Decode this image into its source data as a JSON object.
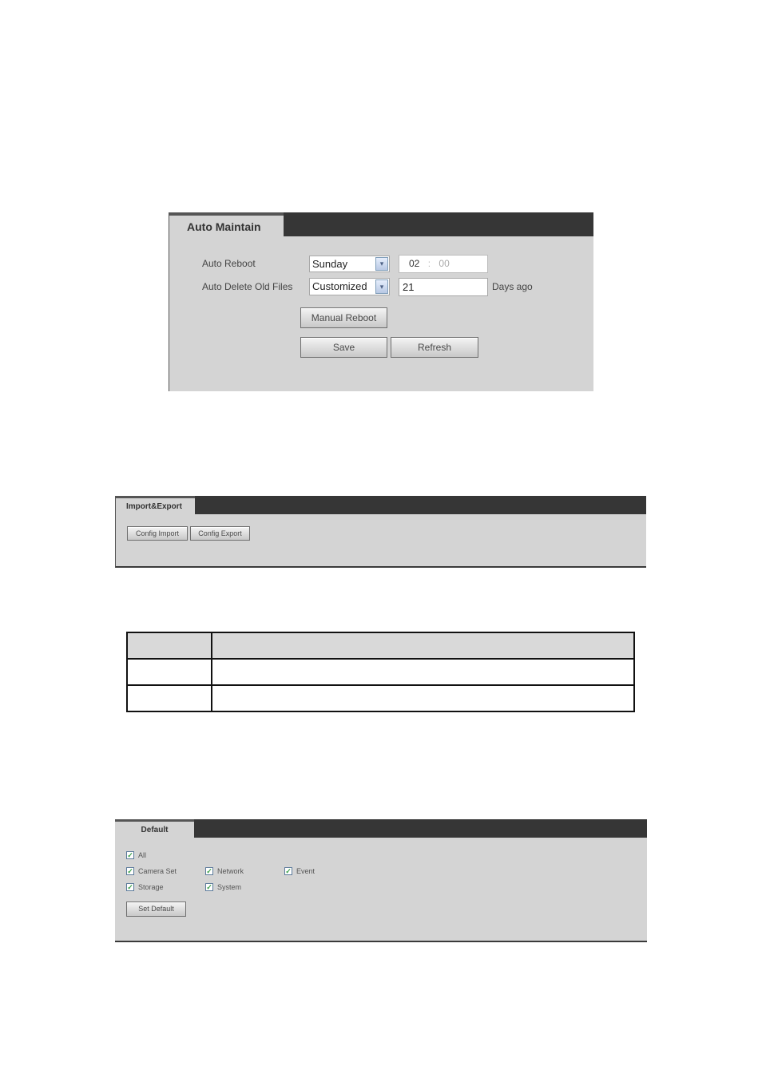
{
  "auto_maintain": {
    "tab_title": "Auto Maintain",
    "auto_reboot_label": "Auto Reboot",
    "auto_reboot_day": "Sunday",
    "auto_reboot_hour": "02",
    "time_separator": ":",
    "auto_reboot_minute": "00",
    "auto_delete_label": "Auto Delete Old Files",
    "auto_delete_mode": "Customized",
    "auto_delete_days": "21",
    "days_suffix": "Days ago",
    "manual_reboot_label": "Manual Reboot",
    "save_label": "Save",
    "refresh_label": "Refresh",
    "dropdown_arrow": "▾"
  },
  "import_export": {
    "tab_title": "Import&Export",
    "config_import_label": "Config Import",
    "config_export_label": "Config Export"
  },
  "table": {
    "rows": [
      [
        "",
        ""
      ],
      [
        "",
        ""
      ],
      [
        "",
        ""
      ]
    ]
  },
  "default": {
    "tab_title": "Default",
    "check_mark": "✓",
    "options": [
      {
        "label": "All",
        "checked": true
      },
      {
        "label": "Camera Set",
        "checked": true
      },
      {
        "label": "Network",
        "checked": true
      },
      {
        "label": "Event",
        "checked": true
      },
      {
        "label": "Storage",
        "checked": true
      },
      {
        "label": "System",
        "checked": true
      }
    ],
    "set_default_label": "Set Default"
  }
}
